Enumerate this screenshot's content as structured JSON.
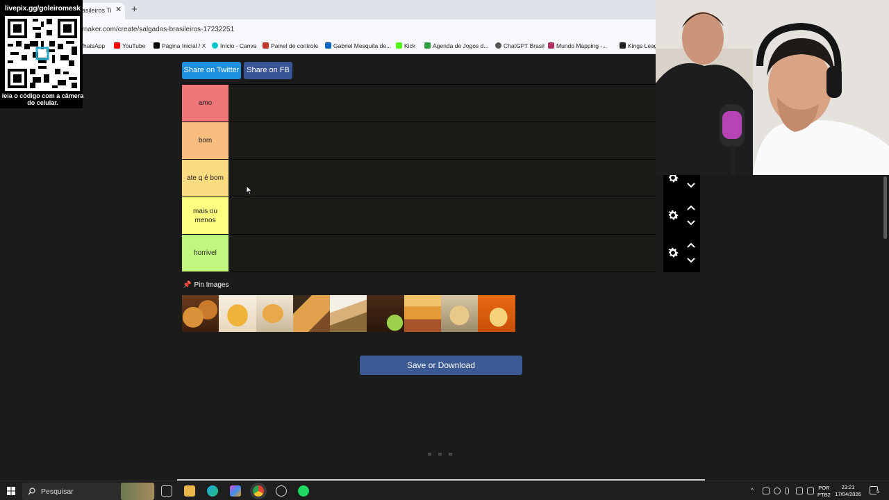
{
  "browser": {
    "tab_title": "asileiros Ti",
    "tab_close": "✕",
    "new_tab": "+",
    "url": "maker.com/create/salgados-brasileiros-17232251",
    "bookmarks": [
      {
        "label": "WhatsApp",
        "color": "#25d366"
      },
      {
        "label": "YouTube",
        "color": "#ff0000"
      },
      {
        "label": "Página Inicial / X",
        "color": "#000000"
      },
      {
        "label": "Início - Canva",
        "color": "#00c4cc"
      },
      {
        "label": "Painel de controle",
        "color": "#c0392b"
      },
      {
        "label": "Gabriel Mesquita de...",
        "color": "#0a66c2"
      },
      {
        "label": "Kick",
        "color": "#53fc18"
      },
      {
        "label": "Agenda de Jogos d...",
        "color": "#2ea043"
      },
      {
        "label": "ChatGPT Brasil",
        "color": "#555555"
      },
      {
        "label": "Mundo Mapping -...",
        "color": "#b03060"
      },
      {
        "label": "Kings Leag",
        "color": "#222222"
      }
    ]
  },
  "qr_overlay": {
    "header": "livepix.gg/goleiromesk",
    "caption": "leia o código com a câmera do celular."
  },
  "page": {
    "share_twitter": "Share on Twitter",
    "share_fb": "Share on FB",
    "tiers": [
      {
        "label": "amo",
        "color": "#f07679"
      },
      {
        "label": "bom",
        "color": "#f9bd7f"
      },
      {
        "label": "ate q é bom",
        "color": "#fbdc81"
      },
      {
        "label": "mais ou menos",
        "color": "#fdfe80"
      },
      {
        "label": "horrivel",
        "color": "#bff77f"
      }
    ],
    "pin_images": "Pin Images",
    "save_button": "Save or Download"
  },
  "taskbar": {
    "search_placeholder": "Pesquisar",
    "lang_line1": "POR",
    "lang_line2": "PTB2",
    "time": "23:21",
    "date": "17/04/2026",
    "notifications": "5"
  }
}
